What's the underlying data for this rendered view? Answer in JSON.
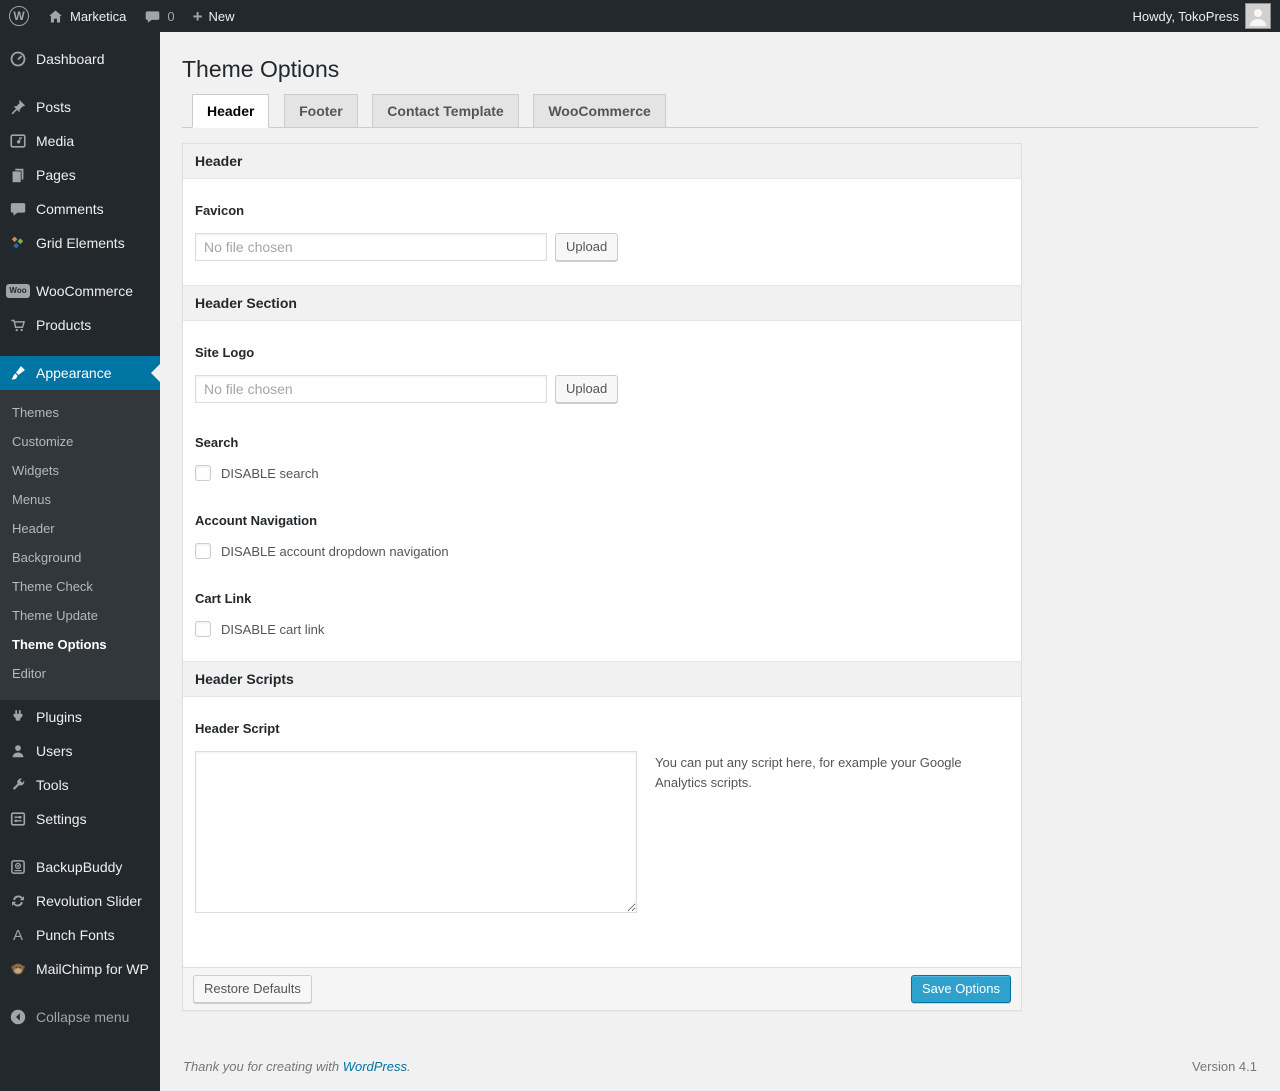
{
  "colors": {
    "admin_bar_bg": "#23282d",
    "menu_bg": "#23282d",
    "submenu_bg": "#32373c",
    "accent": "#0074a2",
    "primary_button_bg": "#2ea2cc",
    "page_bg": "#f1f1f1",
    "link": "#0074a2"
  },
  "admin_bar": {
    "site_name": "Marketica",
    "comments_count": "0",
    "plus_glyph": "+",
    "new_label": "New",
    "howdy": "Howdy, TokoPress"
  },
  "sidebar": {
    "items": [
      "Dashboard",
      "Posts",
      "Media",
      "Pages",
      "Comments",
      "Grid Elements",
      "WooCommerce",
      "Products",
      "Appearance",
      "Plugins",
      "Users",
      "Tools",
      "Settings",
      "BackupBuddy",
      "Revolution Slider",
      "Punch Fonts",
      "MailChimp for WP",
      "Collapse menu"
    ],
    "appearance_submenu": [
      "Themes",
      "Customize",
      "Widgets",
      "Menus",
      "Header",
      "Background",
      "Theme Check",
      "Theme Update",
      "Theme Options",
      "Editor"
    ],
    "woo_badge": "Woo",
    "punch_fonts_glyph": "A"
  },
  "main": {
    "page_title": "Theme Options",
    "tabs": [
      "Header",
      "Footer",
      "Contact Template",
      "WooCommerce"
    ],
    "sections": {
      "header": {
        "title": "Header",
        "favicon_label": "Favicon",
        "file_placeholder": "No file chosen",
        "upload_label": "Upload"
      },
      "header_section": {
        "title": "Header Section",
        "site_logo_label": "Site Logo",
        "file_placeholder": "No file chosen",
        "upload_label": "Upload",
        "search_label": "Search",
        "disable_search_label": "DISABLE search",
        "account_nav_label": "Account Navigation",
        "disable_account_label": "DISABLE account dropdown navigation",
        "cart_link_label": "Cart Link",
        "disable_cart_label": "DISABLE cart link"
      },
      "header_scripts": {
        "title": "Header Scripts",
        "script_label": "Header Script",
        "script_value": "",
        "script_help": "You can put any script here, for example your Google Analytics scripts."
      }
    },
    "actions": {
      "restore_label": "Restore Defaults",
      "save_label": "Save Options"
    }
  },
  "footer": {
    "thanks_prefix": "Thank you for creating with ",
    "wordpress_link": "WordPress",
    "thanks_suffix": ".",
    "version": "Version 4.1"
  }
}
